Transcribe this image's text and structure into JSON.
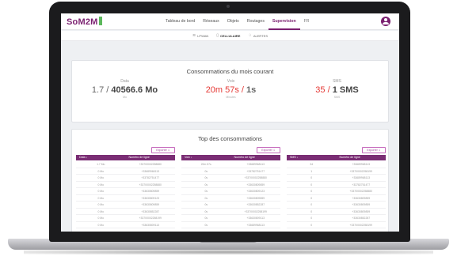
{
  "header": {
    "logo": "SoM2M",
    "nav": [
      "Tableau de bord",
      "Réseaux",
      "Objets",
      "Routages",
      "Supervision",
      "FR"
    ],
    "active_nav": "Supervision"
  },
  "subtabs": [
    {
      "label": "LPWAN",
      "icon": "wifi-icon",
      "active": false
    },
    {
      "label": "CELLULAIRE",
      "icon": "phone-icon",
      "active": true
    },
    {
      "label": "ALERTES",
      "icon": "bell-icon",
      "active": false
    }
  ],
  "consumption": {
    "title": "Consommations du mois courant",
    "stats": [
      {
        "label": "Data",
        "left": "1.7 / ",
        "right": "40566.6 Mo",
        "sub": "Mo"
      },
      {
        "label": "Voix",
        "left": "20m 57s / ",
        "right": "1s",
        "sub": "Minutes"
      },
      {
        "label": "SMS",
        "left": "35 / ",
        "right": "1 SMS",
        "sub": "SMS"
      }
    ]
  },
  "top": {
    "title": "Top des consommations",
    "export_label": "Exporter",
    "tables": [
      {
        "headers": [
          "Data ↓",
          "Numéro de ligne"
        ],
        "rows": [
          [
            "1.7 Mo",
            "+33700002258880"
          ],
          [
            "0 Mo",
            "+33689968113"
          ],
          [
            "0 Mo",
            "+33782751477"
          ],
          [
            "0 Mo",
            "+33700002258880"
          ],
          [
            "0 Mo",
            "+33630809859"
          ],
          [
            "0 Mo",
            "+33630809123"
          ],
          [
            "0 Mo",
            "+33630809859"
          ],
          [
            "0 Mo",
            "+33630852287"
          ],
          [
            "0 Mo",
            "+33700002258199"
          ],
          [
            "0 Mo",
            "+33630809113"
          ]
        ]
      },
      {
        "headers": [
          "Voix ↓",
          "Numéro de ligne"
        ],
        "rows": [
          [
            "20m 57s",
            "+33689968113"
          ],
          [
            "0s",
            "+33782751477"
          ],
          [
            "0s",
            "+33700002258880"
          ],
          [
            "0s",
            "+33630809859"
          ],
          [
            "0s",
            "+33630809123"
          ],
          [
            "0s",
            "+33630809859"
          ],
          [
            "0s",
            "+33630852287"
          ],
          [
            "0s",
            "+33700002258199"
          ],
          [
            "0s",
            "+33630809113"
          ],
          [
            "0s",
            "+33689968113"
          ]
        ]
      },
      {
        "headers": [
          "SMS ↓",
          "Numéro de ligne"
        ],
        "rows": [
          [
            "34",
            "+33689968113"
          ],
          [
            "1",
            "+33700002258199"
          ],
          [
            "0",
            "+33689968113"
          ],
          [
            "0",
            "+33782751477"
          ],
          [
            "0",
            "+33700002258880"
          ],
          [
            "0",
            "+33630809859"
          ],
          [
            "0",
            "+33630809859"
          ],
          [
            "0",
            "+33630809859"
          ],
          [
            "0",
            "+33630852287"
          ],
          [
            "0",
            "+33700002258199"
          ]
        ]
      }
    ]
  },
  "colors": {
    "brand": "#7a1f6f",
    "accent_red": "#e53935"
  }
}
